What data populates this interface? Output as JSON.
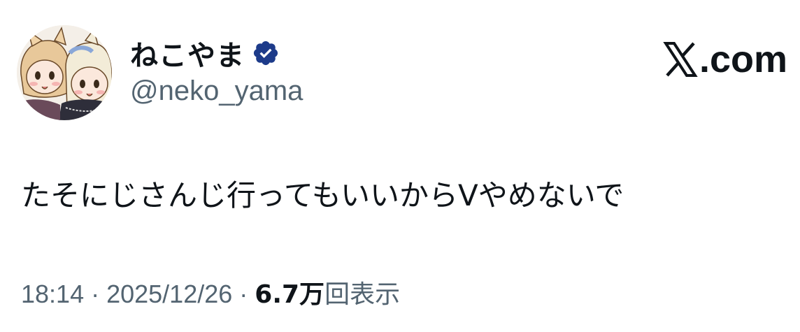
{
  "author": {
    "display_name": "ねこやま",
    "handle": "@neko_yama",
    "verified": true,
    "verified_color": "#1d3b8a"
  },
  "site": {
    "logo_icon": "x-logo-icon",
    "suffix": ".com"
  },
  "tweet": {
    "text": "たそにじさんじ行ってもいいからVやめないで"
  },
  "meta": {
    "time": "18:14",
    "separator": "·",
    "date": "2025/12/26",
    "views_count": "6.7万",
    "views_label": "回表示"
  },
  "colors": {
    "text_primary": "#0f1419",
    "text_secondary": "#536471"
  }
}
